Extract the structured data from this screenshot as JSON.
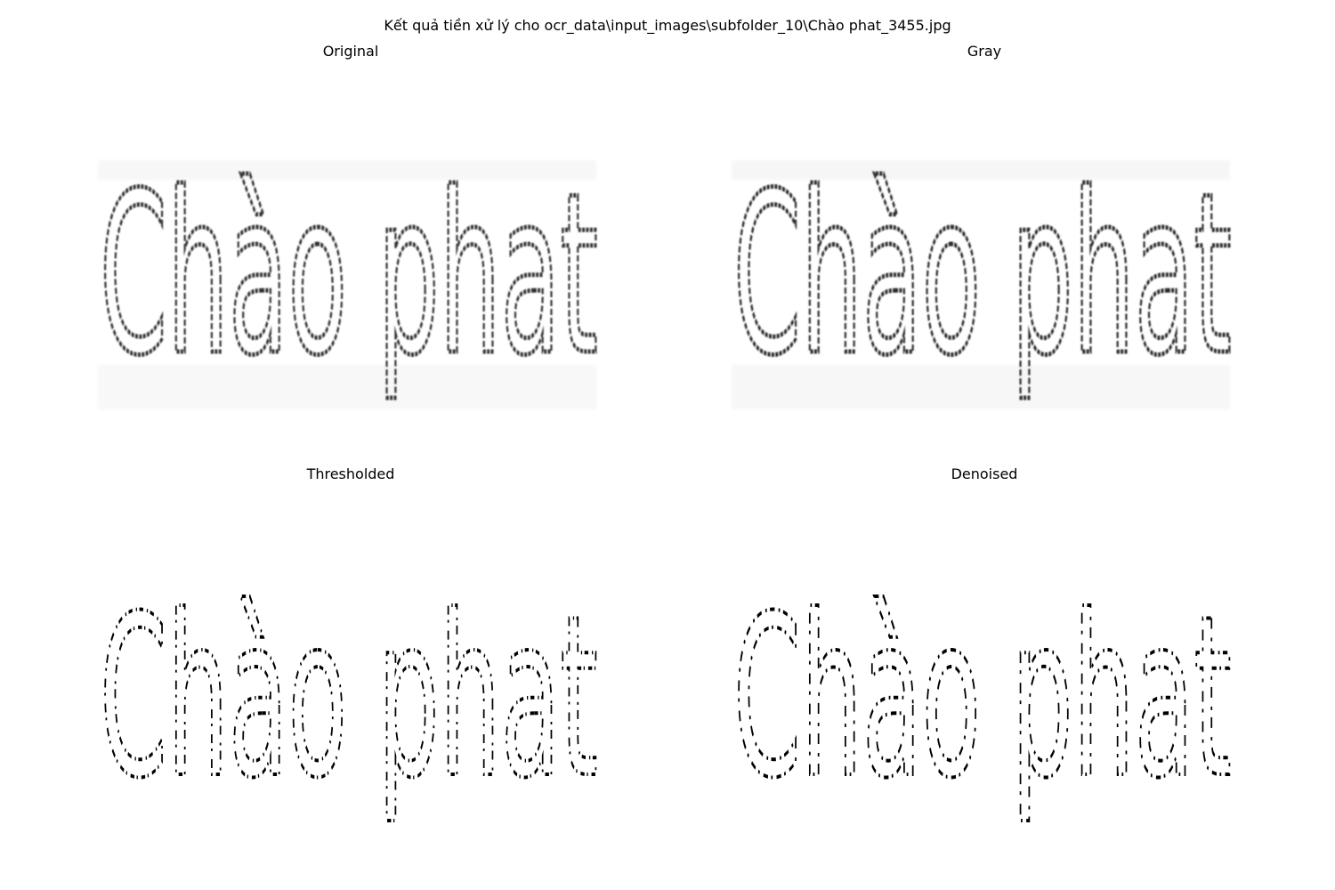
{
  "figure": {
    "suptitle": "Kết quả tiền xử lý cho ocr_data\\input_images\\subfolder_10\\Chào phat_3455.jpg"
  },
  "panels": [
    {
      "id": "original",
      "title": "Original",
      "caption": "Chào phat"
    },
    {
      "id": "gray",
      "title": "Gray",
      "caption": "Chào phat"
    },
    {
      "id": "threshold",
      "title": "Thresholded",
      "caption": "Chào phat"
    },
    {
      "id": "denoised",
      "title": "Denoised",
      "caption": "Chào phat"
    }
  ],
  "colors": {
    "background": "#ffffff",
    "ink": "#000000",
    "soft_ink": "#444444",
    "noise": "#d8d8d8"
  }
}
